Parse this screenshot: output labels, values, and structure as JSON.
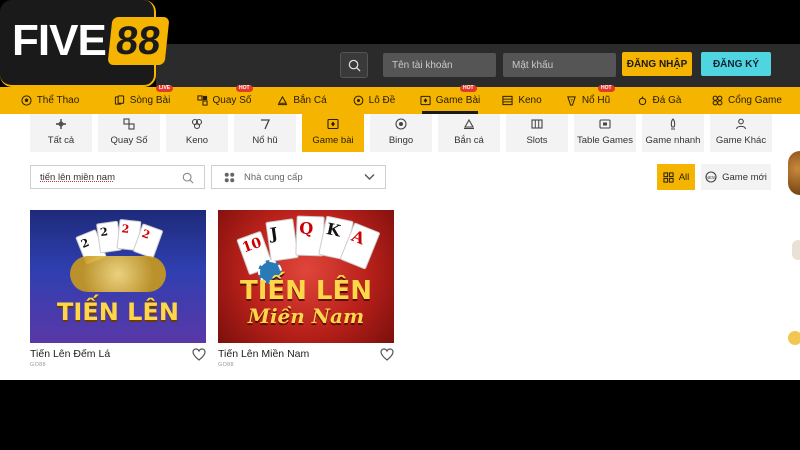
{
  "brand": {
    "five": "FIVE",
    "eight": "88",
    "accent": "#f5b400",
    "register_color": "#4fd5e0"
  },
  "header": {
    "username_placeholder": "Tên tài khoản",
    "password_placeholder": "Mật khẩu",
    "login_label": "ĐĂNG NHẬP",
    "register_label": "ĐĂNG KÝ"
  },
  "nav": {
    "items": [
      {
        "label": "Thể Thao",
        "icon": "soccer-ball-icon",
        "badge": ""
      },
      {
        "label": "Sòng Bài",
        "icon": "cards-icon",
        "badge": "LIVE"
      },
      {
        "label": "Quay Số",
        "icon": "lottery-icon",
        "badge": "HOT"
      },
      {
        "label": "Bắn Cá",
        "icon": "fish-icon",
        "badge": ""
      },
      {
        "label": "Lô Đề",
        "icon": "lotto-icon",
        "badge": ""
      },
      {
        "label": "Game Bài",
        "icon": "card-game-icon",
        "badge": "HOT",
        "active": true
      },
      {
        "label": "Keno",
        "icon": "keno-icon",
        "badge": ""
      },
      {
        "label": "Nổ Hũ",
        "icon": "jackpot-icon",
        "badge": "HOT"
      },
      {
        "label": "Đá Gà",
        "icon": "rooster-icon",
        "badge": ""
      },
      {
        "label": "Cổng Game",
        "icon": "game-portal-icon",
        "badge": ""
      }
    ]
  },
  "categories": {
    "items": [
      {
        "label": "Tất cả",
        "icon": "grid-icon"
      },
      {
        "label": "Quay Số",
        "icon": "lottery-icon"
      },
      {
        "label": "Keno",
        "icon": "keno-icon"
      },
      {
        "label": "Nổ hũ",
        "icon": "jackpot-icon"
      },
      {
        "label": "Game bài",
        "icon": "card-game-icon",
        "active": true
      },
      {
        "label": "Bingo",
        "icon": "bingo-icon"
      },
      {
        "label": "Bắn cá",
        "icon": "fish-icon"
      },
      {
        "label": "Slots",
        "icon": "slots-icon"
      },
      {
        "label": "Table Games",
        "icon": "table-icon"
      },
      {
        "label": "Game nhanh",
        "icon": "rocket-icon"
      },
      {
        "label": "Game Khác",
        "icon": "people-icon"
      }
    ]
  },
  "filters": {
    "search_value": "tiến lên miền nam",
    "provider_placeholder": "Nhà cung cấp",
    "all_label": "All",
    "new_label": "Game mới"
  },
  "games": [
    {
      "title": "Tiến Lên Đếm Lá",
      "provider": "GO88",
      "art_text": "TIẾN LÊN"
    },
    {
      "title": "Tiến Lên Miền Nam",
      "provider": "GO88",
      "art_text": "TIẾN LÊN",
      "art_sub": "Miền Nam"
    }
  ]
}
